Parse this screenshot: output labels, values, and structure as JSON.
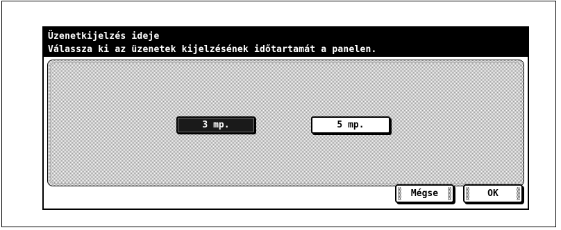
{
  "dialog": {
    "title": "Üzenetkijelzés ideje",
    "description": "Válassza ki az üzenetek kijelzésének időtartamát a panelen."
  },
  "options": [
    {
      "label": "3 mp.",
      "selected": true
    },
    {
      "label": "5 mp.",
      "selected": false
    }
  ],
  "actions": {
    "cancel_label": "Mégse",
    "ok_label": "OK"
  }
}
